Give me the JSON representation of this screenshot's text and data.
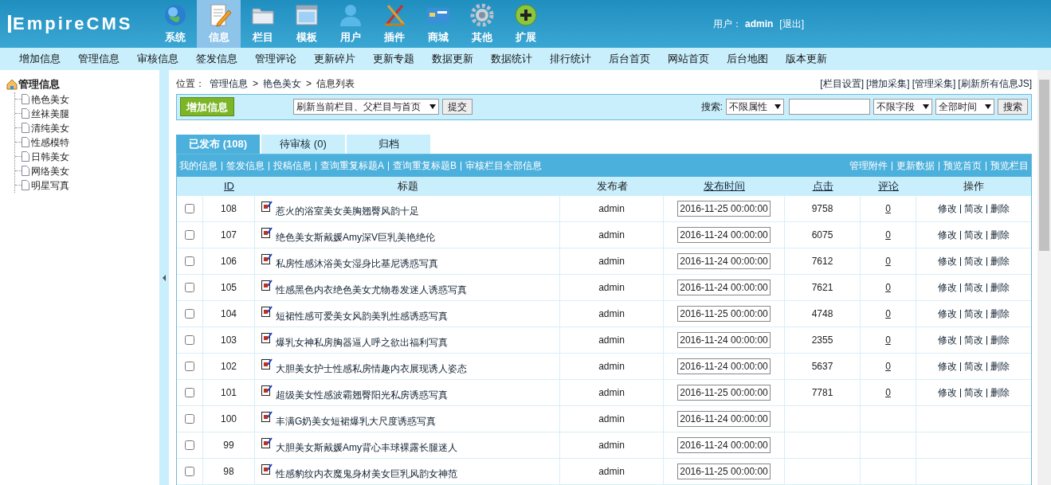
{
  "logo": {
    "text": "EmpireCMS"
  },
  "top_menu": [
    {
      "label": "系统",
      "selected": false
    },
    {
      "label": "信息",
      "selected": true
    },
    {
      "label": "栏目",
      "selected": false
    },
    {
      "label": "模板",
      "selected": false
    },
    {
      "label": "用户",
      "selected": false
    },
    {
      "label": "插件",
      "selected": false
    },
    {
      "label": "商城",
      "selected": false
    },
    {
      "label": "其他",
      "selected": false
    },
    {
      "label": "扩展",
      "selected": false
    }
  ],
  "user": {
    "label": "用户：",
    "name": "admin",
    "logout": "[退出]"
  },
  "sub_menu": [
    "增加信息",
    "管理信息",
    "审核信息",
    "签发信息",
    "管理评论",
    "更新碎片",
    "更新专题",
    "数据更新",
    "数据统计",
    "排行统计",
    "后台首页",
    "网站首页",
    "后台地图",
    "版本更新"
  ],
  "sidebar": {
    "root": "管理信息",
    "children": [
      "艳色美女",
      "丝袜美腿",
      "清纯美女",
      "性感模特",
      "日韩美女",
      "网络美女",
      "明星写真"
    ]
  },
  "breadcrumb": {
    "label": "位置：",
    "items": [
      "管理信息",
      "艳色美女",
      "信息列表"
    ],
    "separator": ">"
  },
  "top_links": [
    "[栏目设置]",
    "[增加采集]",
    "[管理采集]",
    "[刷新所有信息JS]"
  ],
  "toolbar": {
    "add_button": "增加信息",
    "refresh_select": "刷新当前栏目、父栏目与首页",
    "submit": "提交",
    "search_label": "搜索:",
    "attr_select": "不限属性",
    "field_select": "不限字段",
    "time_select": "全部时间",
    "search_button": "搜索"
  },
  "tabs": [
    {
      "label": "已发布 (108)",
      "selected": true
    },
    {
      "label": "待审核 (0)",
      "selected": false
    },
    {
      "label": "归档",
      "selected": false
    }
  ],
  "list_links_left": [
    "我的信息",
    "签发信息",
    "投稿信息",
    "查询重复标题A",
    "查询重复标题B",
    "审核栏目全部信息"
  ],
  "list_links_right": [
    "管理附件",
    "更新数据",
    "预览首页",
    "预览栏目"
  ],
  "table": {
    "columns": [
      {
        "label": "ID",
        "link": true
      },
      {
        "label": "标题",
        "link": false
      },
      {
        "label": "发布者",
        "link": false
      },
      {
        "label": "发布时间",
        "link": true
      },
      {
        "label": "点击",
        "link": true
      },
      {
        "label": "评论",
        "link": true
      },
      {
        "label": "操作",
        "link": false
      }
    ],
    "rows": [
      {
        "checked": false,
        "id": "108",
        "title": "惹火的浴室美女美胸翘臀风韵十足",
        "author": "admin",
        "time": "2016-11-25 00:00:00",
        "clicks": "9758",
        "comments": "0",
        "actions": [
          "修改",
          "简改",
          "删除"
        ]
      },
      {
        "checked": false,
        "id": "107",
        "title": "绝色美女斯戴媛Amy深V巨乳美艳绝伦",
        "author": "admin",
        "time": "2016-11-24 00:00:00",
        "clicks": "6075",
        "comments": "0",
        "actions": [
          "修改",
          "简改",
          "删除"
        ]
      },
      {
        "checked": false,
        "id": "106",
        "title": "私房性感沐浴美女湿身比基尼诱惑写真",
        "author": "admin",
        "time": "2016-11-24 00:00:00",
        "clicks": "7612",
        "comments": "0",
        "actions": [
          "修改",
          "简改",
          "删除"
        ]
      },
      {
        "checked": false,
        "id": "105",
        "title": "性感黑色内衣绝色美女尤物卷发迷人诱惑写真",
        "author": "admin",
        "time": "2016-11-24 00:00:00",
        "clicks": "7621",
        "comments": "0",
        "actions": [
          "修改",
          "简改",
          "删除"
        ]
      },
      {
        "checked": false,
        "id": "104",
        "title": "短裙性感可爱美女风韵美乳性感诱惑写真",
        "author": "admin",
        "time": "2016-11-25 00:00:00",
        "clicks": "4748",
        "comments": "0",
        "actions": [
          "修改",
          "简改",
          "删除"
        ]
      },
      {
        "checked": false,
        "id": "103",
        "title": "爆乳女神私房胸器逼人呼之欲出福利写真",
        "author": "admin",
        "time": "2016-11-24 00:00:00",
        "clicks": "2355",
        "comments": "0",
        "actions": [
          "修改",
          "简改",
          "删除"
        ]
      },
      {
        "checked": false,
        "id": "102",
        "title": "大胆美女护士性感私房情趣内衣展现诱人姿态",
        "author": "admin",
        "time": "2016-11-24 00:00:00",
        "clicks": "5637",
        "comments": "0",
        "actions": [
          "修改",
          "简改",
          "删除"
        ]
      },
      {
        "checked": false,
        "id": "101",
        "title": "超级美女性感波霸翘臀阳光私房诱惑写真",
        "author": "admin",
        "time": "2016-11-25 00:00:00",
        "clicks": "7781",
        "comments": "0",
        "actions": [
          "修改",
          "简改",
          "删除"
        ]
      },
      {
        "checked": false,
        "id": "100",
        "title": "丰满G奶美女短裙爆乳大尺度诱惑写真",
        "author": "admin",
        "time": "2016-11-24 00:00:00"
      },
      {
        "checked": false,
        "id": "99",
        "title": "大胆美女斯戴媛Amy背心丰球裸露长腿迷人",
        "author": "admin",
        "time": "2016-11-24 00:00:00"
      },
      {
        "checked": false,
        "id": "98",
        "title": "性感豹纹内衣魔鬼身材美女巨乳风韵女神范",
        "author": "admin",
        "time": "2016-11-25 00:00:00"
      }
    ]
  }
}
